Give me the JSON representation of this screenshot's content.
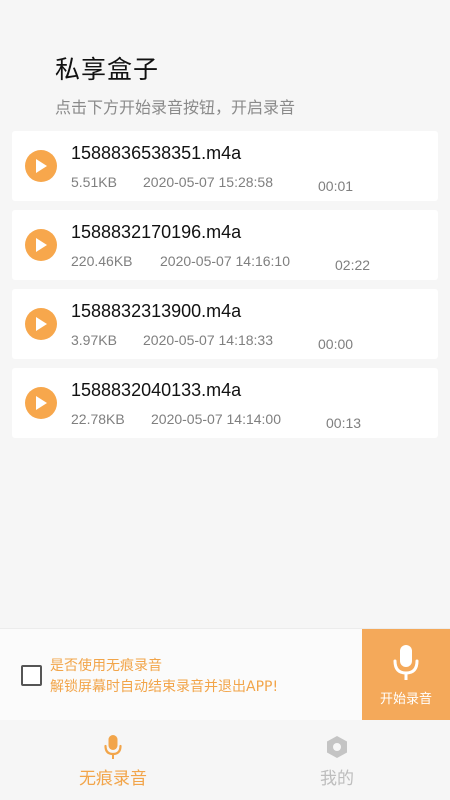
{
  "header": {
    "title": "私享盒子",
    "subtitle": "点击下方开始录音按钮，开启录音"
  },
  "recordings": [
    {
      "name": "1588836538351.m4a",
      "size": "5.51KB",
      "date": "2020-05-07 15:28:58",
      "duration": "00:01"
    },
    {
      "name": "1588832170196.m4a",
      "size": "220.46KB",
      "date": "2020-05-07 14:16:10",
      "duration": "02:22"
    },
    {
      "name": "1588832313900.m4a",
      "size": "3.97KB",
      "date": "2020-05-07 14:18:33",
      "duration": "00:00"
    },
    {
      "name": "1588832040133.m4a",
      "size": "22.78KB",
      "date": "2020-05-07 14:14:00",
      "duration": "00:13"
    }
  ],
  "option": {
    "checked": false,
    "line1": "是否使用无痕录音",
    "line2": "解锁屏幕时自动结束录音并退出APP!"
  },
  "start_button": {
    "label": "开始录音",
    "icon": "microphone-icon"
  },
  "tabs": [
    {
      "label": "无痕录音",
      "icon": "microphone-icon",
      "active": true
    },
    {
      "label": "我的",
      "icon": "hexagon-icon",
      "active": false
    }
  ],
  "colors": {
    "accent": "#f4a95a",
    "accent_text": "#f2a54a",
    "play_button": "#f7a74c",
    "inactive": "#bdbdbd"
  }
}
